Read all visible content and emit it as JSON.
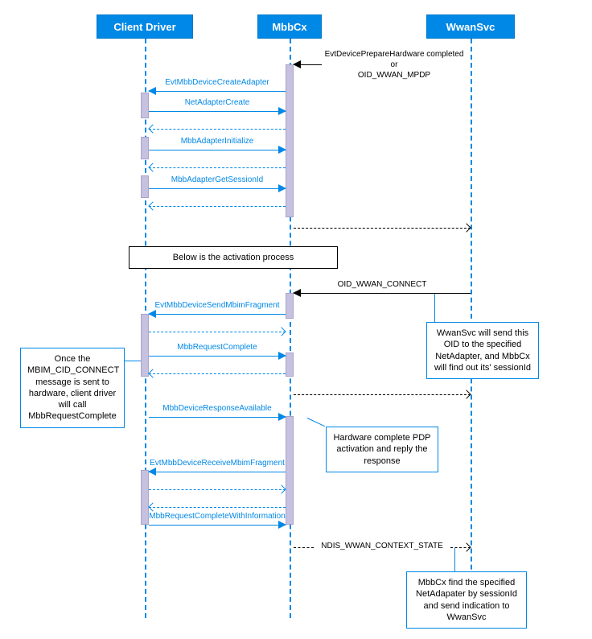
{
  "participants": {
    "client": "Client Driver",
    "mbbcx": "MbbCx",
    "wwansvc": "WwanSvc"
  },
  "top_event": {
    "line1": "EvtDevicePrepareHardware completed",
    "line2": "or",
    "line3": "OID_WWAN_MPDP"
  },
  "messages": {
    "m1": "EvtMbbDeviceCreateAdapter",
    "m2": "NetAdapterCreate",
    "m3": "MbbAdapterInitialize",
    "m4": "MbbAdapterGetSessionId",
    "oid_connect": "OID_WWAN_CONNECT",
    "m5": "EvtMbbDeviceSendMbimFragment",
    "m6": "MbbRequestComplete",
    "m7": "MbbDeviceResponseAvailable",
    "m8": "EvtMbbDeviceReceiveMbimFragment",
    "m9": "MbbRequestCompleteWithInformation",
    "ndis": "NDIS_WWAN_CONTEXT_STATE"
  },
  "notes": {
    "activation_banner": "Below is the activation process",
    "callout_wwansvc": "WwanSvc will send this OID to the specified NetAdapter, and MbbCx will find out its' sessionId",
    "callout_client": "Once the MBIM_CID_CONNECT message is sent to hardware, client driver will call MbbRequestComplete",
    "callout_hardware": "Hardware complete PDP activation and reply the response",
    "callout_final": "MbbCx find the specified NetAdapater by sessionId and send indication to WwanSvc"
  }
}
